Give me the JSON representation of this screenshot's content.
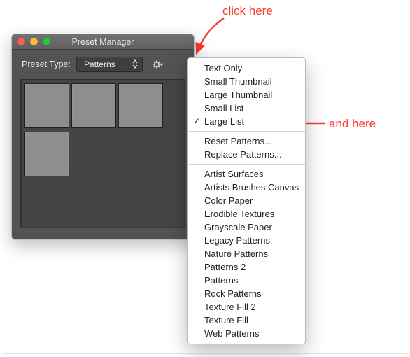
{
  "annotations": {
    "click_here": "click here",
    "and_here": "and here"
  },
  "window": {
    "title": "Preset Manager",
    "preset_type_label": "Preset Type:",
    "select_value": "Patterns"
  },
  "menu": {
    "view": {
      "text_only": "Text Only",
      "small_thumb": "Small Thumbnail",
      "large_thumb": "Large Thumbnail",
      "small_list": "Small List",
      "large_list": "Large List"
    },
    "ops": {
      "reset": "Reset Patterns...",
      "replace": "Replace Patterns..."
    },
    "presets": {
      "artist_surfaces": "Artist Surfaces",
      "artists_brushes_canvas": "Artists Brushes Canvas",
      "color_paper": "Color Paper",
      "erodible_textures": "Erodible Textures",
      "grayscale_paper": "Grayscale Paper",
      "legacy_patterns": "Legacy Patterns",
      "nature_patterns": "Nature Patterns",
      "patterns_2": "Patterns 2",
      "patterns": "Patterns",
      "rock_patterns": "Rock Patterns",
      "texture_fill_2": "Texture Fill 2",
      "texture_fill": "Texture Fill",
      "web_patterns": "Web Patterns"
    }
  }
}
